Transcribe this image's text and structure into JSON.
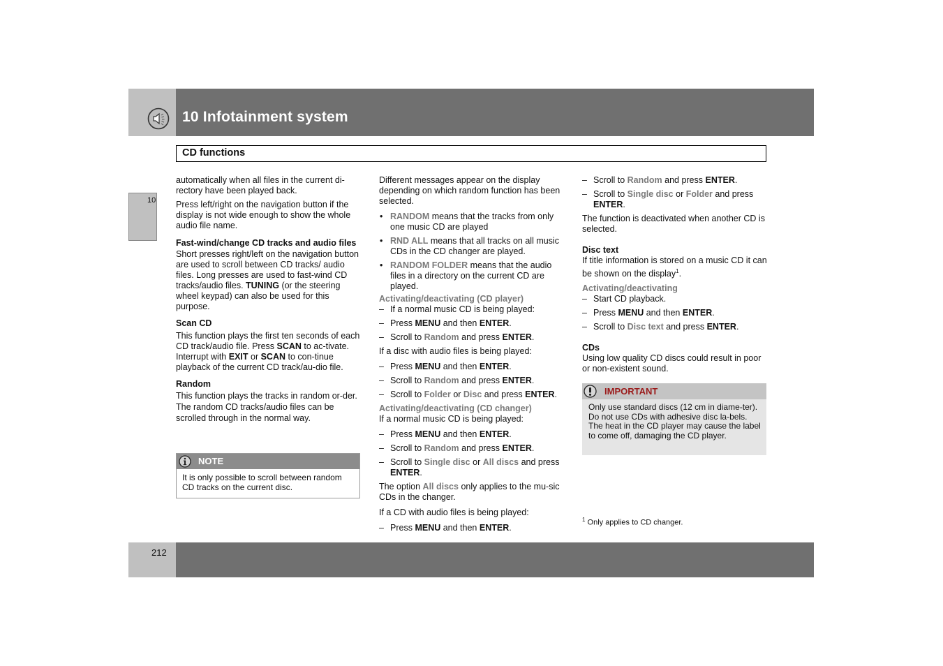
{
  "header": {
    "chapter_title": "10 Infotainment system",
    "chapter_icon": "speaker-icon"
  },
  "section": {
    "title": "CD functions"
  },
  "side_tab": {
    "label": "10"
  },
  "footer": {
    "page_number": "212"
  },
  "col1": {
    "intro1": "automatically when all files in the current di-rectory have been played back.",
    "intro2": "Press left/right on the navigation button if the display is not wide enough to show the whole audio file name.",
    "fastwind": {
      "heading": "Fast-wind/change CD tracks and audio files",
      "text_a": "Short presses right/left on the navigation button are used to scroll between CD tracks/ audio files. Long presses are used to fast-wind CD tracks/audio files. ",
      "text_bold": "TUNING",
      "text_b": " (or the steering wheel keypad) can also be used for this purpose."
    },
    "scan": {
      "heading": "Scan CD",
      "t1": "This function plays the first ten seconds of each CD track/audio file. Press ",
      "b1": "SCAN",
      "t2": " to ac-tivate. Interrupt with ",
      "b2": "EXIT",
      "t3": " or ",
      "b3": "SCAN",
      "t4": " to con-tinue playback of the current CD track/au-dio file."
    },
    "random": {
      "heading": "Random",
      "text": "This function plays the tracks in random or-der. The random CD tracks/audio files can be scrolled through in the normal way."
    },
    "note": {
      "title": "NOTE",
      "icon": "info-icon",
      "text": "It is only possible to scroll between random CD tracks on the current disc."
    }
  },
  "col2": {
    "intro": "Different messages appear on the display depending on which random function has been selected.",
    "bullets": [
      {
        "term": "RANDOM",
        "text": " means that the tracks from only one music CD are played"
      },
      {
        "term": "RND ALL",
        "text": " means that all tracks on all music CDs in the CD changer are played."
      },
      {
        "term": "RANDOM FOLDER",
        "text": " means that the audio files in a directory on the current CD are played."
      }
    ],
    "player": {
      "heading": "Activating/deactivating (CD player)",
      "step0": "If a normal music CD is being played:",
      "press": "Press ",
      "menu": "MENU",
      "and_then": " and then ",
      "enter": "ENTER",
      "dot": ".",
      "scroll_to": "Scroll to ",
      "random": "Random",
      "and_press": " and press ",
      "audio_intro": "If a disc with audio files is being played:",
      "folder": "Folder",
      "or": " or ",
      "disc": "Disc"
    },
    "changer": {
      "heading": "Activating/deactivating (CD changer)",
      "intro": "If a normal music CD is being played:",
      "single_disc": "Single disc",
      "all_discs": "All discs",
      "and_press_nb": " and press",
      "option_a": "The option ",
      "option_b": " only applies to the mu-sic CDs in the changer.",
      "audio_intro": "If a CD with audio files is being played:"
    }
  },
  "col3": {
    "scroll_to": "Scroll to ",
    "random": "Random",
    "and_press": " and press ",
    "enter": "ENTER",
    "dot": ".",
    "single_disc": "Single disc",
    "or": " or ",
    "folder": "Folder",
    "and_press_nb": " and press",
    "deactivated": "The function is deactivated when another CD is selected.",
    "disc_text": {
      "heading": "Disc text",
      "text": "If title information is stored on a music CD it can be shown on the display",
      "footnote_ref": "1",
      "sub": "Activating/deactivating",
      "step1": "Start CD playback.",
      "press": "Press ",
      "menu": "MENU",
      "and_then": " and then ",
      "disc_text_label": "Disc text"
    },
    "cds": {
      "heading": "CDs",
      "text": "Using low quality CD discs could result in poor or non-existent sound."
    },
    "important": {
      "title": "IMPORTANT",
      "icon": "exclamation-icon",
      "text": "Only use standard discs (12 cm in diame-ter). Do not use CDs with adhesive disc la-bels. The heat in the CD player may cause the label to come off, damaging the CD player."
    },
    "footnote": {
      "mark": "1",
      "text": "Only applies to CD changer."
    }
  },
  "colors": {
    "header_bg": "#707070",
    "header_side": "#c0c0c0",
    "accent_gray_text": "#7a7a7a",
    "important_title": "#9b1b1b"
  }
}
